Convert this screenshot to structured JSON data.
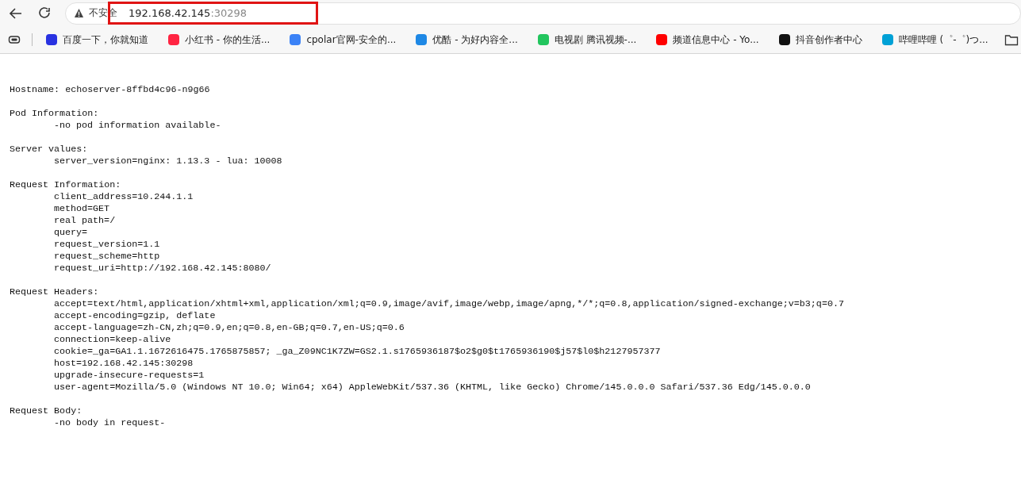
{
  "address_bar": {
    "security_label": "不安全",
    "host": "192.168.42.145",
    "port": ":30298",
    "highlighted": true
  },
  "bookmarks": [
    {
      "label": "百度一下，你就知道",
      "color": "#2932e1"
    },
    {
      "label": "小红书 - 你的生活...",
      "color": "#ff2442"
    },
    {
      "label": "cpolar官网-安全的...",
      "color": "#3b82f6"
    },
    {
      "label": "优酷 - 为好内容全...",
      "color": "#1e88e5"
    },
    {
      "label": "电视剧 腾讯视频-...",
      "color": "#22c55e"
    },
    {
      "label": "频道信息中心 - Yo...",
      "color": "#ff0000"
    },
    {
      "label": "抖音创作者中心",
      "color": "#111111"
    },
    {
      "label": "哔哩哔哩 (゜-゜)つ...",
      "color": "#00a1d6"
    }
  ],
  "page": {
    "hostname": "Hostname: echoserver-8ffbd4c96-n9g66",
    "sections": [
      {
        "heading": "Pod Information:",
        "lines": [
          "-no pod information available-"
        ]
      },
      {
        "heading": "Server values:",
        "lines": [
          "server_version=nginx: 1.13.3 - lua: 10008"
        ]
      },
      {
        "heading": "Request Information:",
        "lines": [
          "client_address=10.244.1.1",
          "method=GET",
          "real path=/",
          "query=",
          "request_version=1.1",
          "request_scheme=http",
          "request_uri=http://192.168.42.145:8080/"
        ]
      },
      {
        "heading": "Request Headers:",
        "lines": [
          "accept=text/html,application/xhtml+xml,application/xml;q=0.9,image/avif,image/webp,image/apng,*/*;q=0.8,application/signed-exchange;v=b3;q=0.7",
          "accept-encoding=gzip, deflate",
          "accept-language=zh-CN,zh;q=0.9,en;q=0.8,en-GB;q=0.7,en-US;q=0.6",
          "connection=keep-alive",
          "cookie=_ga=GA1.1.1672616475.1765875857; _ga_Z09NC1K7ZW=GS2.1.s1765936187$o2$g0$t1765936190$j57$l0$h2127957377",
          "host=192.168.42.145:30298",
          "upgrade-insecure-requests=1",
          "user-agent=Mozilla/5.0 (Windows NT 10.0; Win64; x64) AppleWebKit/537.36 (KHTML, like Gecko) Chrome/145.0.0.0 Safari/537.36 Edg/145.0.0.0"
        ]
      },
      {
        "heading": "Request Body:",
        "lines": [
          "-no body in request-"
        ]
      }
    ]
  }
}
